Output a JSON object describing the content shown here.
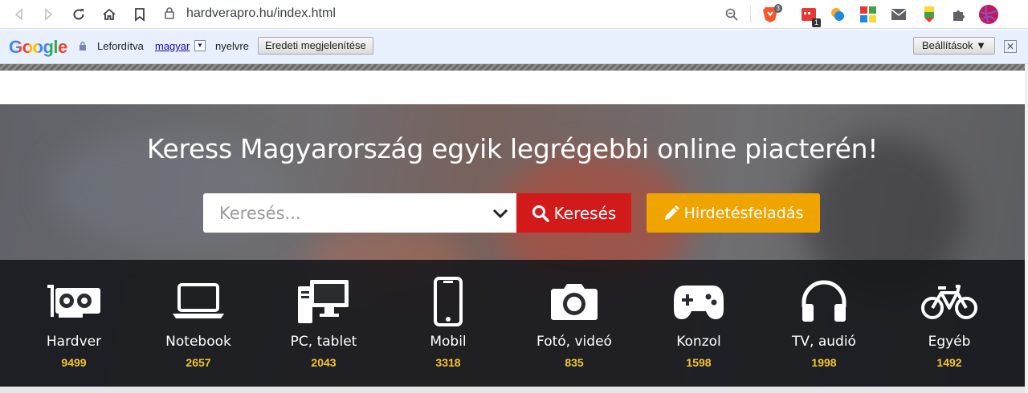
{
  "browser": {
    "url": "hardverapro.hu/index.html",
    "ext_brave_badge": "3",
    "ext_cal_badge": "1"
  },
  "translate_bar": {
    "logo": "Google",
    "translated_label": "Lefordítva",
    "language": "magyar",
    "language_suffix": "nyelvre",
    "original_button": "Eredeti megjelenítése",
    "settings_button": "Beállítások ▼",
    "close": "✕"
  },
  "hero": {
    "title": "Keress Magyarország egyik legrégebbi online piacterén!",
    "search_placeholder": "Keresés...",
    "search_button": "Keresés",
    "post_button": "Hirdetésfeladás"
  },
  "categories": [
    {
      "name": "Hardver",
      "count": "9499",
      "icon": "graphics-card-icon"
    },
    {
      "name": "Notebook",
      "count": "2657",
      "icon": "laptop-icon"
    },
    {
      "name": "PC, tablet",
      "count": "2043",
      "icon": "desktop-pc-icon"
    },
    {
      "name": "Mobil",
      "count": "3318",
      "icon": "mobile-phone-icon"
    },
    {
      "name": "Fotó, videó",
      "count": "835",
      "icon": "camera-icon"
    },
    {
      "name": "Konzol",
      "count": "1598",
      "icon": "gamepad-icon"
    },
    {
      "name": "TV, audió",
      "count": "1998",
      "icon": "headphones-icon"
    },
    {
      "name": "Egyéb",
      "count": "1492",
      "icon": "bicycle-icon"
    }
  ],
  "colors": {
    "search_button": "#d21a1a",
    "post_button": "#f0a400",
    "count_color": "#f4c430"
  }
}
